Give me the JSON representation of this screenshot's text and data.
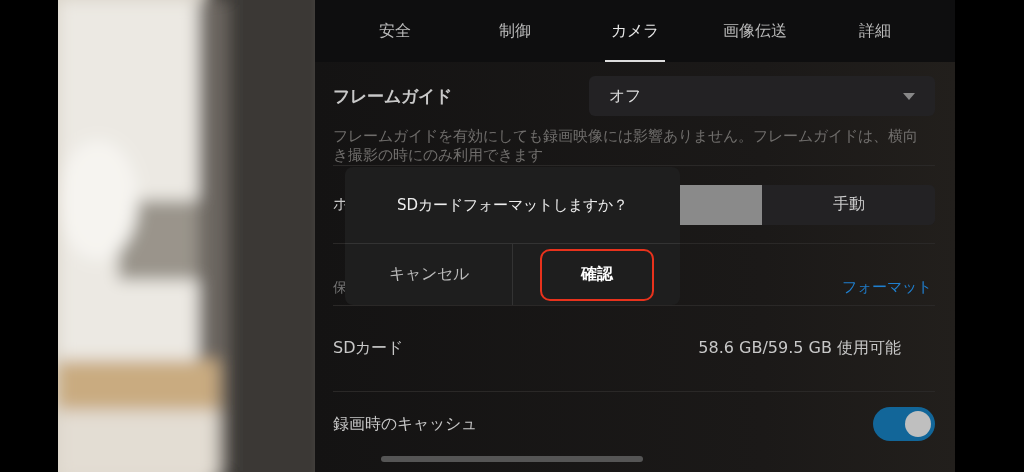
{
  "tabs": [
    {
      "label": "安全",
      "selected": false
    },
    {
      "label": "制御",
      "selected": false
    },
    {
      "label": "カメラ",
      "selected": true
    },
    {
      "label": "画像伝送",
      "selected": false
    },
    {
      "label": "詳細",
      "selected": false
    }
  ],
  "frame_guide": {
    "label": "フレームガイド",
    "value": "オフ",
    "note": "フレームガイドを有効にしても録画映像には影響ありません。フレームガイドは、横向き撮影の時にのみ利用できます"
  },
  "mode_row": {
    "label": "ホ",
    "segments": [
      {
        "selected": true
      },
      {
        "label": "手動",
        "selected": false
      }
    ]
  },
  "storage_row": {
    "label": "保",
    "action": "フォーマット"
  },
  "sd_card": {
    "label": "SDカード",
    "value": "58.6 GB/59.5 GB 使用可能"
  },
  "cache": {
    "label": "録画時のキャッシュ",
    "on": true
  },
  "dialog": {
    "message": "SDカードフォーマットしますか？",
    "buttons": [
      {
        "label": "キャンセル",
        "selected": false
      },
      {
        "label": "確認",
        "selected": true
      }
    ]
  }
}
